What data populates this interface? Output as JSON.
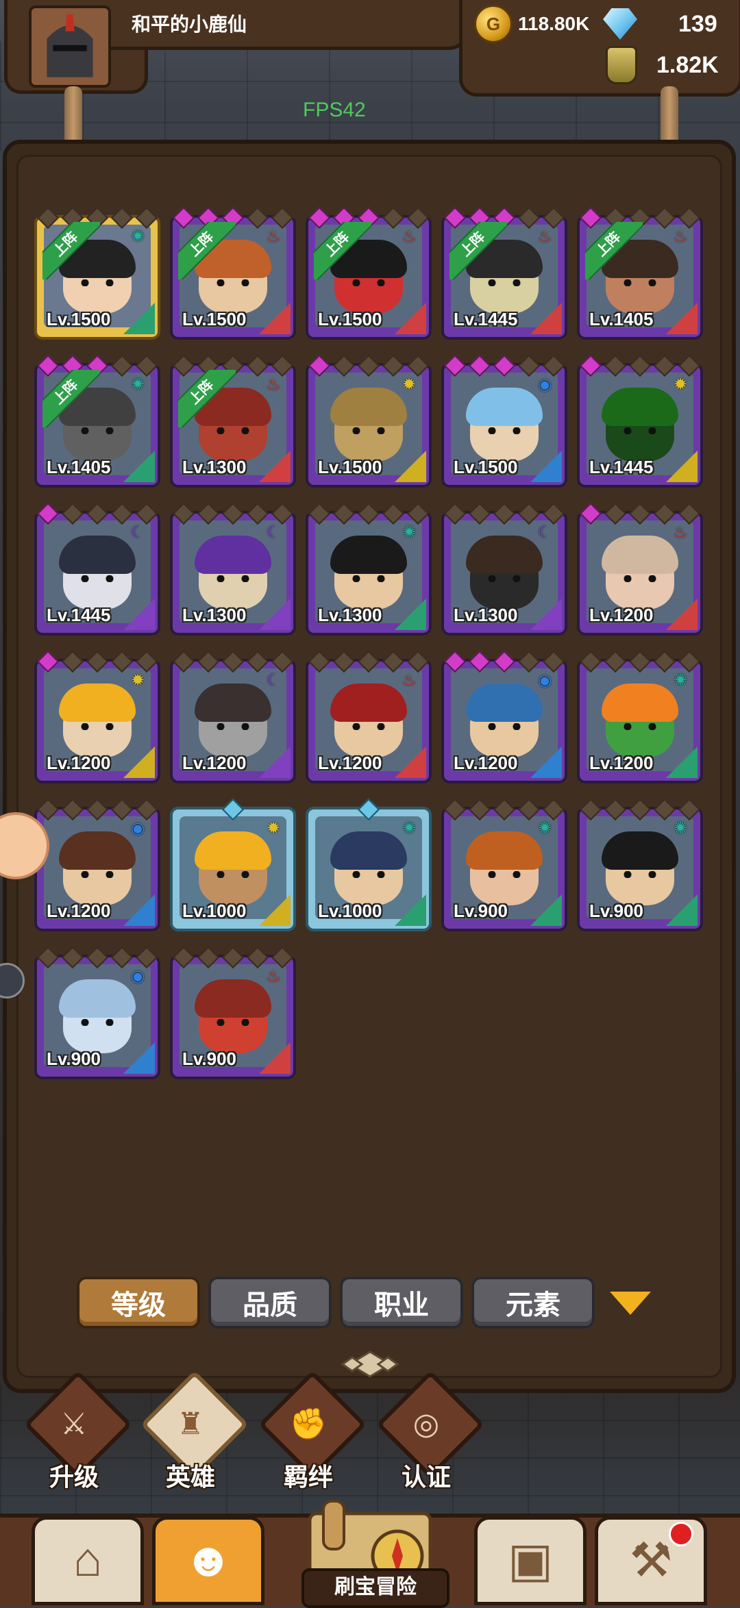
{
  "player": {
    "name": "和平的小鹿仙"
  },
  "resources": {
    "gold": "118.80K",
    "gems": "139",
    "potion": "1.82K"
  },
  "fps": "FPS42",
  "on_team_label": "上阵",
  "heroes": [
    {
      "level": "Lv.1500",
      "rarity": "gold",
      "stars": [
        "off",
        "off",
        "off",
        "off",
        "off"
      ],
      "element": "wind",
      "on_team": true,
      "class_color": "#2aa070",
      "face": "#f0d0b0",
      "hair": "#222"
    },
    {
      "level": "Lv.1500",
      "rarity": "purple",
      "stars": [
        "on",
        "on",
        "on",
        "off",
        "off"
      ],
      "element": "fire",
      "on_team": true,
      "class_color": "#d04040",
      "face": "#e8c8a0",
      "hair": "#c0602a"
    },
    {
      "level": "Lv.1500",
      "rarity": "purple",
      "stars": [
        "on",
        "on",
        "on",
        "off",
        "off"
      ],
      "element": "fire",
      "on_team": true,
      "class_color": "#d04040",
      "face": "#d03030",
      "hair": "#1a1a1a"
    },
    {
      "level": "Lv.1445",
      "rarity": "purple",
      "stars": [
        "on",
        "on",
        "on",
        "off",
        "off"
      ],
      "element": "fire",
      "on_team": true,
      "class_color": "#d04040",
      "face": "#d8d0a0",
      "hair": "#2a2a2a"
    },
    {
      "level": "Lv.1405",
      "rarity": "purple",
      "stars": [
        "on",
        "off",
        "off",
        "off",
        "off"
      ],
      "element": "fire",
      "on_team": true,
      "class_color": "#d04040",
      "face": "#c08060",
      "hair": "#3a2a20"
    },
    {
      "level": "Lv.1405",
      "rarity": "purple",
      "stars": [
        "on",
        "on",
        "on",
        "off",
        "off"
      ],
      "element": "wind",
      "on_team": true,
      "class_color": "#2aa070",
      "face": "#606060",
      "hair": "#404040"
    },
    {
      "level": "Lv.1300",
      "rarity": "purple",
      "stars": [
        "off",
        "off",
        "off",
        "off",
        "off"
      ],
      "element": "fire",
      "on_team": true,
      "class_color": "#d04040",
      "face": "#b04030",
      "hair": "#8a2a20"
    },
    {
      "level": "Lv.1500",
      "rarity": "purple",
      "stars": [
        "on",
        "off",
        "off",
        "off",
        "off"
      ],
      "element": "light",
      "on_team": false,
      "class_color": "#d0b020",
      "face": "#c0a060",
      "hair": "#a08040"
    },
    {
      "level": "Lv.1500",
      "rarity": "purple",
      "stars": [
        "on",
        "on",
        "on",
        "off",
        "off"
      ],
      "element": "water",
      "on_team": false,
      "class_color": "#3080d0",
      "face": "#e8d0b0",
      "hair": "#80c0e8"
    },
    {
      "level": "Lv.1445",
      "rarity": "purple",
      "stars": [
        "on",
        "off",
        "off",
        "off",
        "off"
      ],
      "element": "light",
      "on_team": false,
      "class_color": "#d0b020",
      "face": "#1a4a1a",
      "hair": "#1a6a1a"
    },
    {
      "level": "Lv.1445",
      "rarity": "purple",
      "stars": [
        "on",
        "off",
        "off",
        "off",
        "off"
      ],
      "element": "dark",
      "on_team": false,
      "class_color": "#8040c0",
      "face": "#e0e0e8",
      "hair": "#2a3040"
    },
    {
      "level": "Lv.1300",
      "rarity": "purple",
      "stars": [
        "off",
        "off",
        "off",
        "off",
        "off"
      ],
      "element": "dark",
      "on_team": false,
      "class_color": "#8040c0",
      "face": "#e0d0b0",
      "hair": "#6030a0"
    },
    {
      "level": "Lv.1300",
      "rarity": "purple",
      "stars": [
        "off",
        "off",
        "off",
        "off",
        "off"
      ],
      "element": "wind",
      "on_team": false,
      "class_color": "#2aa070",
      "face": "#e8c8a0",
      "hair": "#1a1a1a"
    },
    {
      "level": "Lv.1300",
      "rarity": "purple",
      "stars": [
        "off",
        "off",
        "off",
        "off",
        "off"
      ],
      "element": "dark",
      "on_team": false,
      "class_color": "#8040c0",
      "face": "#2a2a2a",
      "hair": "#3a2a20"
    },
    {
      "level": "Lv.1200",
      "rarity": "purple",
      "stars": [
        "on",
        "off",
        "off",
        "off",
        "off"
      ],
      "element": "fire",
      "on_team": false,
      "class_color": "#d04040",
      "face": "#e8c8b0",
      "hair": "#d0b8a0"
    },
    {
      "level": "Lv.1200",
      "rarity": "purple",
      "stars": [
        "on",
        "off",
        "off",
        "off",
        "off"
      ],
      "element": "light",
      "on_team": false,
      "class_color": "#d0b020",
      "face": "#e8d0b0",
      "hair": "#f0b020"
    },
    {
      "level": "Lv.1200",
      "rarity": "purple",
      "stars": [
        "off",
        "off",
        "off",
        "off",
        "off"
      ],
      "element": "dark",
      "on_team": false,
      "class_color": "#8040c0",
      "face": "#a0a0a0",
      "hair": "#3a3030"
    },
    {
      "level": "Lv.1200",
      "rarity": "purple",
      "stars": [
        "off",
        "off",
        "off",
        "off",
        "off"
      ],
      "element": "fire",
      "on_team": false,
      "class_color": "#d04040",
      "face": "#e8c8a0",
      "hair": "#a02020"
    },
    {
      "level": "Lv.1200",
      "rarity": "purple",
      "stars": [
        "on",
        "on",
        "on",
        "off",
        "off"
      ],
      "element": "water",
      "on_team": false,
      "class_color": "#3080d0",
      "face": "#e8c8a0",
      "hair": "#3070b0"
    },
    {
      "level": "Lv.1200",
      "rarity": "purple",
      "stars": [
        "off",
        "off",
        "off",
        "off",
        "off"
      ],
      "element": "wind",
      "on_team": false,
      "class_color": "#2aa070",
      "face": "#40a040",
      "hair": "#f08020"
    },
    {
      "level": "Lv.1200",
      "rarity": "purple",
      "stars": [
        "off",
        "off",
        "off",
        "off",
        "off"
      ],
      "element": "water",
      "on_team": false,
      "class_color": "#3080d0",
      "face": "#e8c8a0",
      "hair": "#5a3020"
    },
    {
      "level": "Lv.1000",
      "rarity": "blue",
      "stars": [
        "cy"
      ],
      "element": "light",
      "on_team": false,
      "class_color": "#d0b020",
      "face": "#c09060",
      "hair": "#f0b020"
    },
    {
      "level": "Lv.1000",
      "rarity": "blue",
      "stars": [
        "cy"
      ],
      "element": "wind",
      "on_team": false,
      "class_color": "#2aa070",
      "face": "#e8c8a0",
      "hair": "#2a3a60"
    },
    {
      "level": "Lv.900",
      "rarity": "purple",
      "stars": [
        "off",
        "off",
        "off",
        "off",
        "off"
      ],
      "element": "wind",
      "on_team": false,
      "class_color": "#2aa070",
      "face": "#e8c0a0",
      "hair": "#c06020"
    },
    {
      "level": "Lv.900",
      "rarity": "purple",
      "stars": [
        "off",
        "off",
        "off",
        "off",
        "off"
      ],
      "element": "wind",
      "on_team": false,
      "class_color": "#2aa070",
      "face": "#e8c8a0",
      "hair": "#1a1a1a"
    },
    {
      "level": "Lv.900",
      "rarity": "purple",
      "stars": [
        "off",
        "off",
        "off",
        "off",
        "off"
      ],
      "element": "water",
      "on_team": false,
      "class_color": "#3080d0",
      "face": "#d0e0f0",
      "hair": "#a0c0e0"
    },
    {
      "level": "Lv.900",
      "rarity": "purple",
      "stars": [
        "off",
        "off",
        "off",
        "off",
        "off"
      ],
      "element": "fire",
      "on_team": false,
      "class_color": "#d04040",
      "face": "#d04030",
      "hair": "#8a2a20"
    }
  ],
  "filter_tabs": [
    {
      "label": "等级",
      "active": true
    },
    {
      "label": "品质",
      "active": false
    },
    {
      "label": "职业",
      "active": false
    },
    {
      "label": "元素",
      "active": false
    }
  ],
  "sub_nav": [
    {
      "label": "升级",
      "icon": "sword-icon",
      "active": false
    },
    {
      "label": "英雄",
      "icon": "hero-icon",
      "active": true
    },
    {
      "label": "羁绊",
      "icon": "fist-icon",
      "active": false
    },
    {
      "label": "认证",
      "icon": "eye-icon",
      "active": false
    }
  ],
  "bottom_nav": {
    "adventure_label": "刷宝冒险"
  },
  "colors": {
    "accent": "#b07a3a",
    "panel": "#3a2a1c",
    "gold": "#e8c24a",
    "purple": "#6c3aa8"
  }
}
